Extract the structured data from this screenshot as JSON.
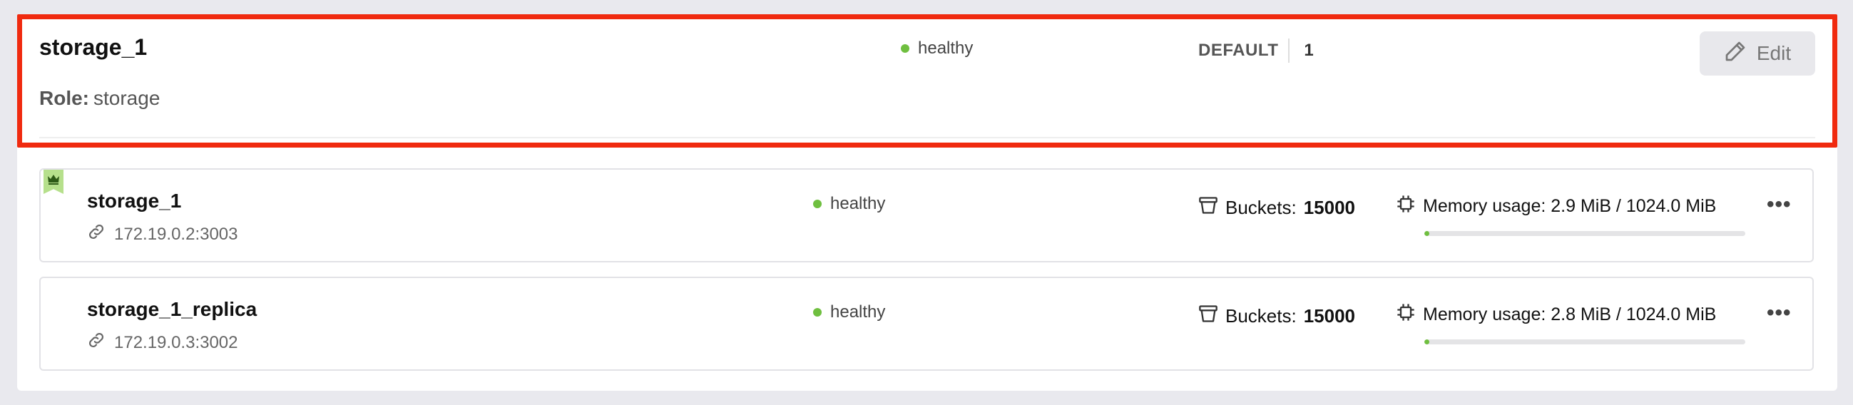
{
  "replicaset": {
    "name": "storage_1",
    "role_label": "Role:",
    "role_value": "storage",
    "status": "healthy",
    "weight_label": "DEFAULT",
    "weight_value": "1",
    "edit_label": "Edit"
  },
  "instances": [
    {
      "name": "storage_1",
      "uri": "172.19.0.2:3003",
      "status": "healthy",
      "buckets_label": "Buckets:",
      "buckets_value": "15000",
      "memory_text": "Memory usage: 2.9 MiB / 1024.0 MiB",
      "memory_fraction": 0.0028,
      "leader": true
    },
    {
      "name": "storage_1_replica",
      "uri": "172.19.0.3:3002",
      "status": "healthy",
      "buckets_label": "Buckets:",
      "buckets_value": "15000",
      "memory_text": "Memory usage: 2.8 MiB / 1024.0 MiB",
      "memory_fraction": 0.0027,
      "leader": false
    }
  ],
  "colors": {
    "healthy": "#6fbf3f",
    "highlight": "#f02a0f"
  },
  "icons": {
    "edit": "pencil-icon",
    "uri": "link-icon",
    "buckets": "bucket-icon",
    "memory": "chip-icon",
    "more": "more-icon",
    "leader": "crown-icon"
  }
}
